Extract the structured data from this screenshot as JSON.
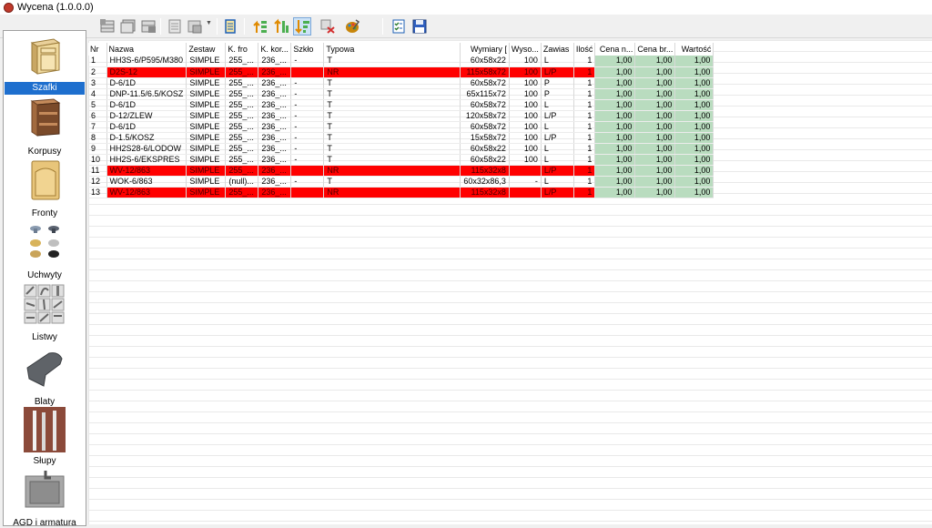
{
  "window": {
    "title": "Wycena (1.0.0.0)"
  },
  "toolbar": {
    "buttons": [
      {
        "icon": "table-add-icon"
      },
      {
        "icon": "table-copy-icon"
      },
      {
        "icon": "table-delete-icon"
      },
      {
        "icon": "print-icon"
      },
      {
        "icon": "print-menu-icon"
      },
      {
        "icon": "scroll-icon"
      },
      {
        "icon": "sort-up-icon"
      },
      {
        "icon": "sort-asc-icon"
      },
      {
        "icon": "sort-desc-icon"
      },
      {
        "icon": "recalc-icon"
      },
      {
        "icon": "palette-icon"
      },
      {
        "icon": "checklist-icon"
      },
      {
        "icon": "save-icon"
      }
    ]
  },
  "sidebar": {
    "items": [
      {
        "label": "Szafki",
        "icon": "cabinet-icon",
        "selected": true
      },
      {
        "label": "Korpusy",
        "icon": "carcass-icon"
      },
      {
        "label": "Fronty",
        "icon": "front-icon"
      },
      {
        "label": "Uchwyty",
        "icon": "handles-icon"
      },
      {
        "label": "Listwy",
        "icon": "moldings-icon"
      },
      {
        "label": "Blaty",
        "icon": "countertop-icon"
      },
      {
        "label": "Słupy",
        "icon": "posts-icon"
      },
      {
        "label": "AGD i armatura",
        "icon": "sink-icon"
      }
    ]
  },
  "table": {
    "columns": [
      "Nr",
      "Nazwa",
      "Zestaw",
      "K. fro",
      "K. kor...",
      "Szkło",
      "Typowa",
      "Wymiary [",
      "Wyso...",
      "Zawias",
      "Ilość",
      "Cena n...",
      "Cena br...",
      "Wartość"
    ],
    "rows": [
      {
        "red": false,
        "cells": [
          "1",
          "HH3S-6/P595/M380",
          "SIMPLE",
          "255_...",
          "236_...",
          "-",
          "T",
          "60x58x22",
          "100",
          "L",
          "1",
          "1,00",
          "1,00",
          "1,00"
        ]
      },
      {
        "red": true,
        "cells": [
          "2",
          "D2S-12",
          "SIMPLE",
          "255_...",
          "236_...",
          "",
          "NR",
          "115x58x72",
          "100",
          "L/P",
          "1",
          "1,00",
          "1,00",
          "1,00"
        ]
      },
      {
        "red": false,
        "cells": [
          "3",
          "D-6/1D",
          "SIMPLE",
          "255_...",
          "236_...",
          "-",
          "T",
          "60x58x72",
          "100",
          "P",
          "1",
          "1,00",
          "1,00",
          "1,00"
        ]
      },
      {
        "red": false,
        "cells": [
          "4",
          "DNP-11.5/6.5/KOSZ",
          "SIMPLE",
          "255_...",
          "236_...",
          "-",
          "T",
          "65x115x72",
          "100",
          "P",
          "1",
          "1,00",
          "1,00",
          "1,00"
        ]
      },
      {
        "red": false,
        "cells": [
          "5",
          "D-6/1D",
          "SIMPLE",
          "255_...",
          "236_...",
          "-",
          "T",
          "60x58x72",
          "100",
          "L",
          "1",
          "1,00",
          "1,00",
          "1,00"
        ]
      },
      {
        "red": false,
        "cells": [
          "6",
          "D-12/ZLEW",
          "SIMPLE",
          "255_...",
          "236_...",
          "-",
          "T",
          "120x58x72",
          "100",
          "L/P",
          "1",
          "1,00",
          "1,00",
          "1,00"
        ]
      },
      {
        "red": false,
        "cells": [
          "7",
          "D-6/1D",
          "SIMPLE",
          "255_...",
          "236_...",
          "-",
          "T",
          "60x58x72",
          "100",
          "L",
          "1",
          "1,00",
          "1,00",
          "1,00"
        ]
      },
      {
        "red": false,
        "cells": [
          "8",
          "D-1.5/KOSZ",
          "SIMPLE",
          "255_...",
          "236_...",
          "-",
          "T",
          "15x58x72",
          "100",
          "L/P",
          "1",
          "1,00",
          "1,00",
          "1,00"
        ]
      },
      {
        "red": false,
        "cells": [
          "9",
          "HH2S28-6/LODOW",
          "SIMPLE",
          "255_...",
          "236_...",
          "-",
          "T",
          "60x58x22",
          "100",
          "L",
          "1",
          "1,00",
          "1,00",
          "1,00"
        ]
      },
      {
        "red": false,
        "cells": [
          "10",
          "HH2S-6/EKSPRES",
          "SIMPLE",
          "255_...",
          "236_...",
          "-",
          "T",
          "60x58x22",
          "100",
          "L",
          "1",
          "1,00",
          "1,00",
          "1,00"
        ]
      },
      {
        "red": true,
        "cells": [
          "11",
          "WV-12/863",
          "SIMPLE",
          "255_...",
          "236_...",
          "",
          "NR",
          "115x32x8",
          "",
          "L/P",
          "1",
          "1,00",
          "1,00",
          "1,00"
        ]
      },
      {
        "red": false,
        "cells": [
          "12",
          "WOK-6/863",
          "SIMPLE",
          "(null)...",
          "236_...",
          "-",
          "T",
          "60x32x86,3",
          "-",
          "L",
          "1",
          "1,00",
          "1,00",
          "1,00"
        ]
      },
      {
        "red": true,
        "cells": [
          "13",
          "WV-12/863",
          "SIMPLE",
          "255_...",
          "236_...",
          "",
          "NR",
          "115x32x8",
          "",
          "L/P",
          "1",
          "1,00",
          "1,00",
          "1,00"
        ]
      }
    ]
  },
  "colors": {
    "highlight_red": "#ff0000",
    "price_green": "#b9dcbf",
    "selection_blue": "#1e6fce"
  }
}
